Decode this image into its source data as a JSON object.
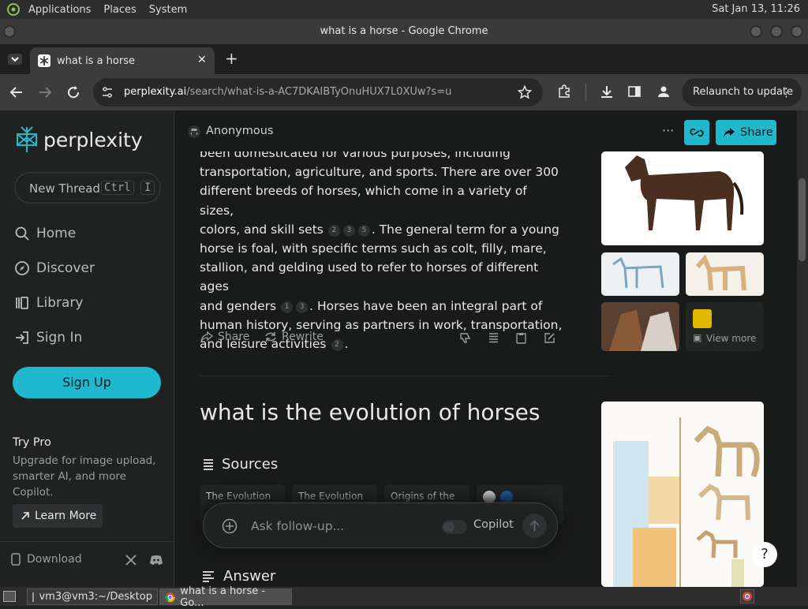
{
  "system_bar": {
    "menus": [
      "Applications",
      "Places",
      "System"
    ],
    "clock": "Sat Jan 13, 11:26"
  },
  "window": {
    "title": "what is a horse - Google Chrome"
  },
  "tab": {
    "title": "what is a horse"
  },
  "omnibox": {
    "domain": "perplexity.ai",
    "path": "/search/what-is-a-AC7DKAIBTyOnuHUX7L0XUw?s=u"
  },
  "toolbar": {
    "relaunch_label": "Relaunch to update"
  },
  "sidebar": {
    "brand": "perplexity",
    "new_thread": "New Thread",
    "shortcut_keys": [
      "Ctrl",
      "I"
    ],
    "nav": [
      "Home",
      "Discover",
      "Library",
      "Sign In"
    ],
    "signup": "Sign Up",
    "try_pro_title": "Try Pro",
    "try_pro_text": "Upgrade for image upload, smarter AI, and more Copilot.",
    "learn_more": "Learn More",
    "download": "Download"
  },
  "header": {
    "user": "Anonymous",
    "share": "Share"
  },
  "answer1": {
    "line0": "been domesticated for various purposes, including",
    "line1": "transportation, agriculture, and sports. There are over 300",
    "line2": "different breeds of horses, which come in a variety of sizes,",
    "line3a": "colors, and skill sets",
    "c1": [
      "2",
      "3",
      "5"
    ],
    "line3b": ". The general term for a young",
    "line4": "horse is foal, with specific terms such as colt, filly, mare,",
    "line5": "stallion, and gelding used to refer to horses of different ages",
    "line6a": "and genders",
    "c2": [
      "1",
      "3"
    ],
    "line6b": ". Horses have been an integral part of",
    "line7": "human history, serving as partners in work, transportation,",
    "line8a": "and leisure activities",
    "c3": [
      "2"
    ],
    "line8b": ".",
    "share": "Share",
    "rewrite": "Rewrite"
  },
  "view_more": "View more",
  "question2": {
    "title": "what is the evolution of horses",
    "sources": "Sources",
    "source_cards": [
      "The Evolution",
      "The Evolution",
      "Origins of the"
    ],
    "answer_label": "Answer"
  },
  "followup": {
    "placeholder": "Ask follow-up...",
    "copilot": "Copilot"
  },
  "help": "?",
  "taskbar": {
    "terminal": "vm3@vm3:~/Desktop",
    "chrome": "what is a horse - Go..."
  }
}
